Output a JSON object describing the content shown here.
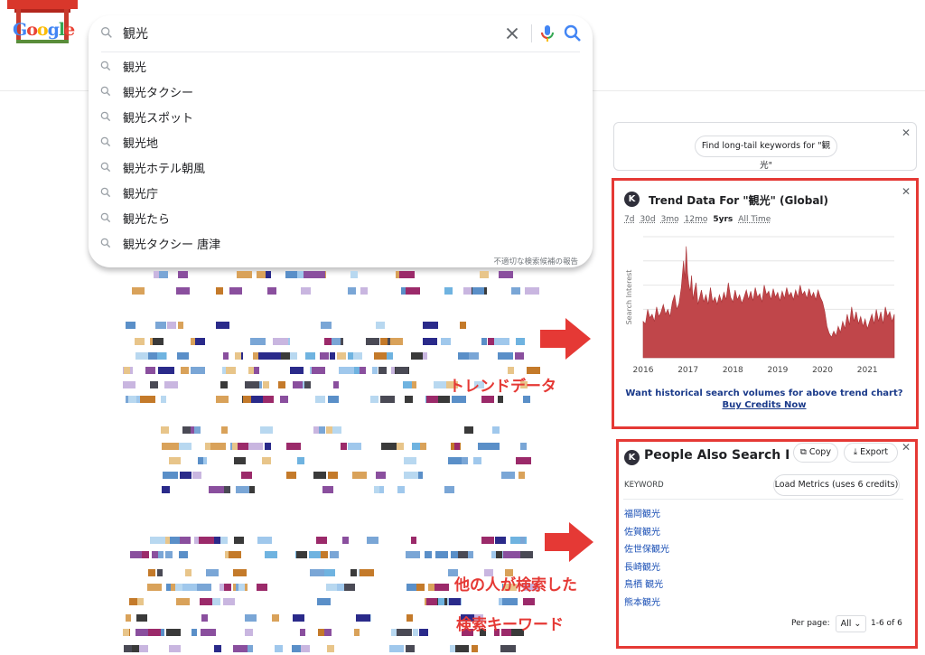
{
  "logo": {
    "text": "Google"
  },
  "search": {
    "query": "観光",
    "suggestions": [
      "観光",
      "観光タクシー",
      "観光スポット",
      "観光地",
      "観光ホテル朝風",
      "観光庁",
      "観光たら",
      "観光タクシー 唐津"
    ],
    "report_text": "不適切な検索候補の報告"
  },
  "colors": {
    "accent_red": "#e53935",
    "chart_fill": "#c0464a",
    "link_blue": "#1a4fb5"
  },
  "longtail": {
    "button_label": "Find long-tail keywords for \"観光\""
  },
  "trend": {
    "title": "Trend Data For \"観光\" (Global)",
    "ranges": [
      "7d",
      "30d",
      "3mo",
      "12mo",
      "5yrs",
      "All Time"
    ],
    "active_range": "5yrs",
    "ylabel": "Search Interest",
    "promo_text": "Want historical search volumes for above trend chart?",
    "buy_label": "Buy Credits Now"
  },
  "chart_data": {
    "type": "area",
    "title": "Trend Data For \"観光\" (Global)",
    "xlabel": "",
    "ylabel": "Search Interest",
    "x_ticks": [
      "2016",
      "2017",
      "2018",
      "2019",
      "2020",
      "2021"
    ],
    "x_range": [
      2016,
      2021.6
    ],
    "ylim": [
      0,
      100
    ],
    "grid": true,
    "series": [
      {
        "values": [
          [
            2016.0,
            30
          ],
          [
            2016.05,
            28
          ],
          [
            2016.1,
            40
          ],
          [
            2016.15,
            33
          ],
          [
            2016.2,
            36
          ],
          [
            2016.25,
            30
          ],
          [
            2016.3,
            42
          ],
          [
            2016.35,
            34
          ],
          [
            2016.4,
            38
          ],
          [
            2016.45,
            44
          ],
          [
            2016.5,
            36
          ],
          [
            2016.55,
            40
          ],
          [
            2016.6,
            34
          ],
          [
            2016.65,
            46
          ],
          [
            2016.7,
            52
          ],
          [
            2016.75,
            40
          ],
          [
            2016.8,
            45
          ],
          [
            2016.85,
            58
          ],
          [
            2016.9,
            80
          ],
          [
            2016.93,
            65
          ],
          [
            2016.96,
            92
          ],
          [
            2016.99,
            70
          ],
          [
            2017.02,
            60
          ],
          [
            2017.05,
            55
          ],
          [
            2017.08,
            68
          ],
          [
            2017.11,
            48
          ],
          [
            2017.14,
            55
          ],
          [
            2017.18,
            62
          ],
          [
            2017.22,
            44
          ],
          [
            2017.26,
            50
          ],
          [
            2017.3,
            56
          ],
          [
            2017.35,
            46
          ],
          [
            2017.4,
            52
          ],
          [
            2017.45,
            44
          ],
          [
            2017.5,
            58
          ],
          [
            2017.55,
            46
          ],
          [
            2017.6,
            50
          ],
          [
            2017.65,
            44
          ],
          [
            2017.7,
            52
          ],
          [
            2017.75,
            46
          ],
          [
            2017.8,
            54
          ],
          [
            2017.85,
            48
          ],
          [
            2017.9,
            62
          ],
          [
            2017.95,
            50
          ],
          [
            2018.0,
            46
          ],
          [
            2018.05,
            56
          ],
          [
            2018.1,
            48
          ],
          [
            2018.15,
            52
          ],
          [
            2018.2,
            45
          ],
          [
            2018.25,
            50
          ],
          [
            2018.3,
            56
          ],
          [
            2018.35,
            48
          ],
          [
            2018.4,
            55
          ],
          [
            2018.45,
            47
          ],
          [
            2018.5,
            58
          ],
          [
            2018.55,
            50
          ],
          [
            2018.6,
            53
          ],
          [
            2018.65,
            46
          ],
          [
            2018.7,
            60
          ],
          [
            2018.75,
            52
          ],
          [
            2018.8,
            55
          ],
          [
            2018.85,
            48
          ],
          [
            2018.9,
            57
          ],
          [
            2018.95,
            50
          ],
          [
            2019.0,
            54
          ],
          [
            2019.05,
            47
          ],
          [
            2019.1,
            55
          ],
          [
            2019.15,
            49
          ],
          [
            2019.2,
            58
          ],
          [
            2019.25,
            51
          ],
          [
            2019.3,
            54
          ],
          [
            2019.35,
            48
          ],
          [
            2019.4,
            56
          ],
          [
            2019.45,
            50
          ],
          [
            2019.5,
            60
          ],
          [
            2019.55,
            52
          ],
          [
            2019.6,
            55
          ],
          [
            2019.65,
            49
          ],
          [
            2019.7,
            57
          ],
          [
            2019.75,
            50
          ],
          [
            2019.8,
            54
          ],
          [
            2019.85,
            48
          ],
          [
            2019.9,
            56
          ],
          [
            2019.95,
            50
          ],
          [
            2020.0,
            46
          ],
          [
            2020.05,
            38
          ],
          [
            2020.1,
            26
          ],
          [
            2020.15,
            20
          ],
          [
            2020.2,
            17
          ],
          [
            2020.25,
            22
          ],
          [
            2020.3,
            18
          ],
          [
            2020.35,
            26
          ],
          [
            2020.4,
            21
          ],
          [
            2020.45,
            30
          ],
          [
            2020.5,
            24
          ],
          [
            2020.55,
            36
          ],
          [
            2020.6,
            27
          ],
          [
            2020.65,
            42
          ],
          [
            2020.7,
            30
          ],
          [
            2020.75,
            38
          ],
          [
            2020.8,
            28
          ],
          [
            2020.85,
            34
          ],
          [
            2020.9,
            26
          ],
          [
            2020.95,
            32
          ],
          [
            2021.0,
            24
          ],
          [
            2021.05,
            30
          ],
          [
            2021.1,
            36
          ],
          [
            2021.15,
            28
          ],
          [
            2021.2,
            40
          ],
          [
            2021.25,
            30
          ],
          [
            2021.3,
            38
          ],
          [
            2021.35,
            28
          ],
          [
            2021.4,
            42
          ],
          [
            2021.45,
            34
          ],
          [
            2021.5,
            38
          ],
          [
            2021.55,
            30
          ],
          [
            2021.6,
            36
          ]
        ]
      }
    ]
  },
  "pasf": {
    "title": "People Also Search Fo",
    "copy_label": "Copy",
    "export_label": "Export",
    "column_header": "KEYWORD",
    "load_metrics_label": "Load Metrics (uses 6 credits)",
    "keywords": [
      "福岡観光",
      "佐賀観光",
      "佐世保観光",
      "長崎観光",
      "鳥栖 観光",
      "熊本観光"
    ],
    "per_page_label": "Per page:",
    "per_page_value": "All",
    "count_text": "1-6 of 6"
  },
  "annotations": {
    "trend_label": "トレンドデータ",
    "pasf_label_line1": "他の人が検索した",
    "pasf_label_line2": "検索キーワード"
  }
}
